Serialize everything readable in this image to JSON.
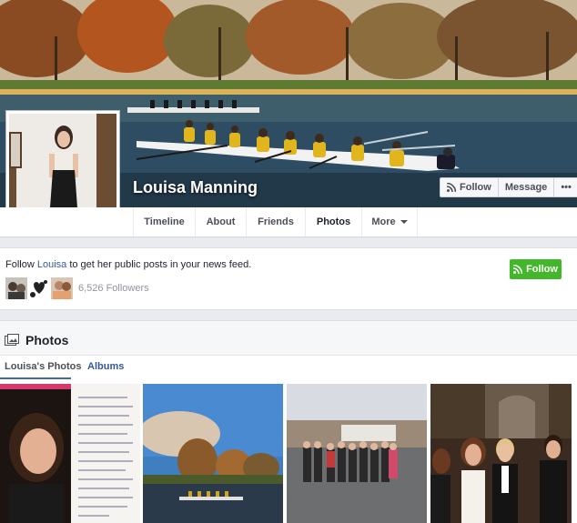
{
  "profile": {
    "name": "Louisa Manning"
  },
  "cover_buttons": {
    "follow": "Follow",
    "message": "Message",
    "more": "•••"
  },
  "tabs": [
    {
      "label": "Timeline"
    },
    {
      "label": "About"
    },
    {
      "label": "Friends"
    },
    {
      "label": "Photos",
      "active": true
    },
    {
      "label": "More"
    }
  ],
  "follow_box": {
    "text_before": "Follow ",
    "name_link": "Louisa",
    "text_after": " to get her public posts in your news feed.",
    "followers": "6,526 Followers",
    "button": "Follow"
  },
  "photos_section": {
    "title": "Photos",
    "subtabs": [
      "Louisa's Photos",
      "Albums"
    ]
  },
  "colors": {
    "link": "#365899",
    "accent": "#4267b2",
    "follow_green": "#42b72a"
  }
}
